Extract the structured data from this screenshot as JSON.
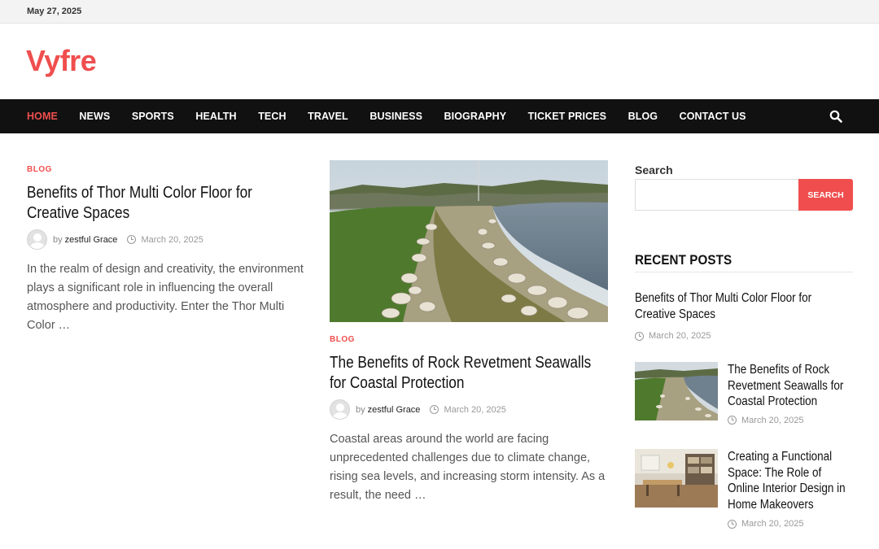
{
  "topbar": {
    "date": "May 27, 2025"
  },
  "brand": {
    "name": "Vyfre"
  },
  "nav": {
    "items": [
      {
        "label": "HOME",
        "active": true
      },
      {
        "label": "NEWS"
      },
      {
        "label": "SPORTS"
      },
      {
        "label": "HEALTH"
      },
      {
        "label": "TECH"
      },
      {
        "label": "TRAVEL"
      },
      {
        "label": "BUSINESS"
      },
      {
        "label": "BIOGRAPHY"
      },
      {
        "label": "TICKET PRICES"
      },
      {
        "label": "BLOG"
      },
      {
        "label": "CONTACT US"
      }
    ],
    "search_icon": "search-icon"
  },
  "posts": [
    {
      "category": "BLOG",
      "title": "Benefits of Thor Multi Color Floor for Creative Spaces",
      "by": "by",
      "author": "zestful Grace",
      "date": "March 20, 2025",
      "excerpt": "In the realm of design and creativity, the environment plays a significant role in influencing the overall atmosphere and productivity. Enter the Thor Multi Color …"
    },
    {
      "category": "BLOG",
      "title": "The Benefits of Rock Revetment Seawalls for Coastal Protection",
      "by": "by",
      "author": "zestful Grace",
      "date": "March 20, 2025",
      "excerpt": "Coastal areas around the world are facing unprecedented challenges due to climate change, rising sea levels, and increasing storm intensity. As a result, the need …"
    }
  ],
  "sidebar": {
    "search_label": "Search",
    "search_placeholder": "",
    "search_button": "SEARCH",
    "recent_heading": "RECENT POSTS",
    "recent": [
      {
        "title": "Benefits of Thor Multi Color Floor for Creative Spaces",
        "date": "March 20, 2025"
      },
      {
        "title": "The Benefits of Rock Revetment Seawalls for Coastal Protection",
        "date": "March 20, 2025"
      },
      {
        "title": "Creating a Functional Space: The Role of Online Interior Design in Home Makeovers",
        "date": "March 20, 2025"
      }
    ]
  },
  "colors": {
    "accent": "#f04e4e",
    "nav_bg": "#111111",
    "topbar_bg": "#f3f3f3"
  }
}
